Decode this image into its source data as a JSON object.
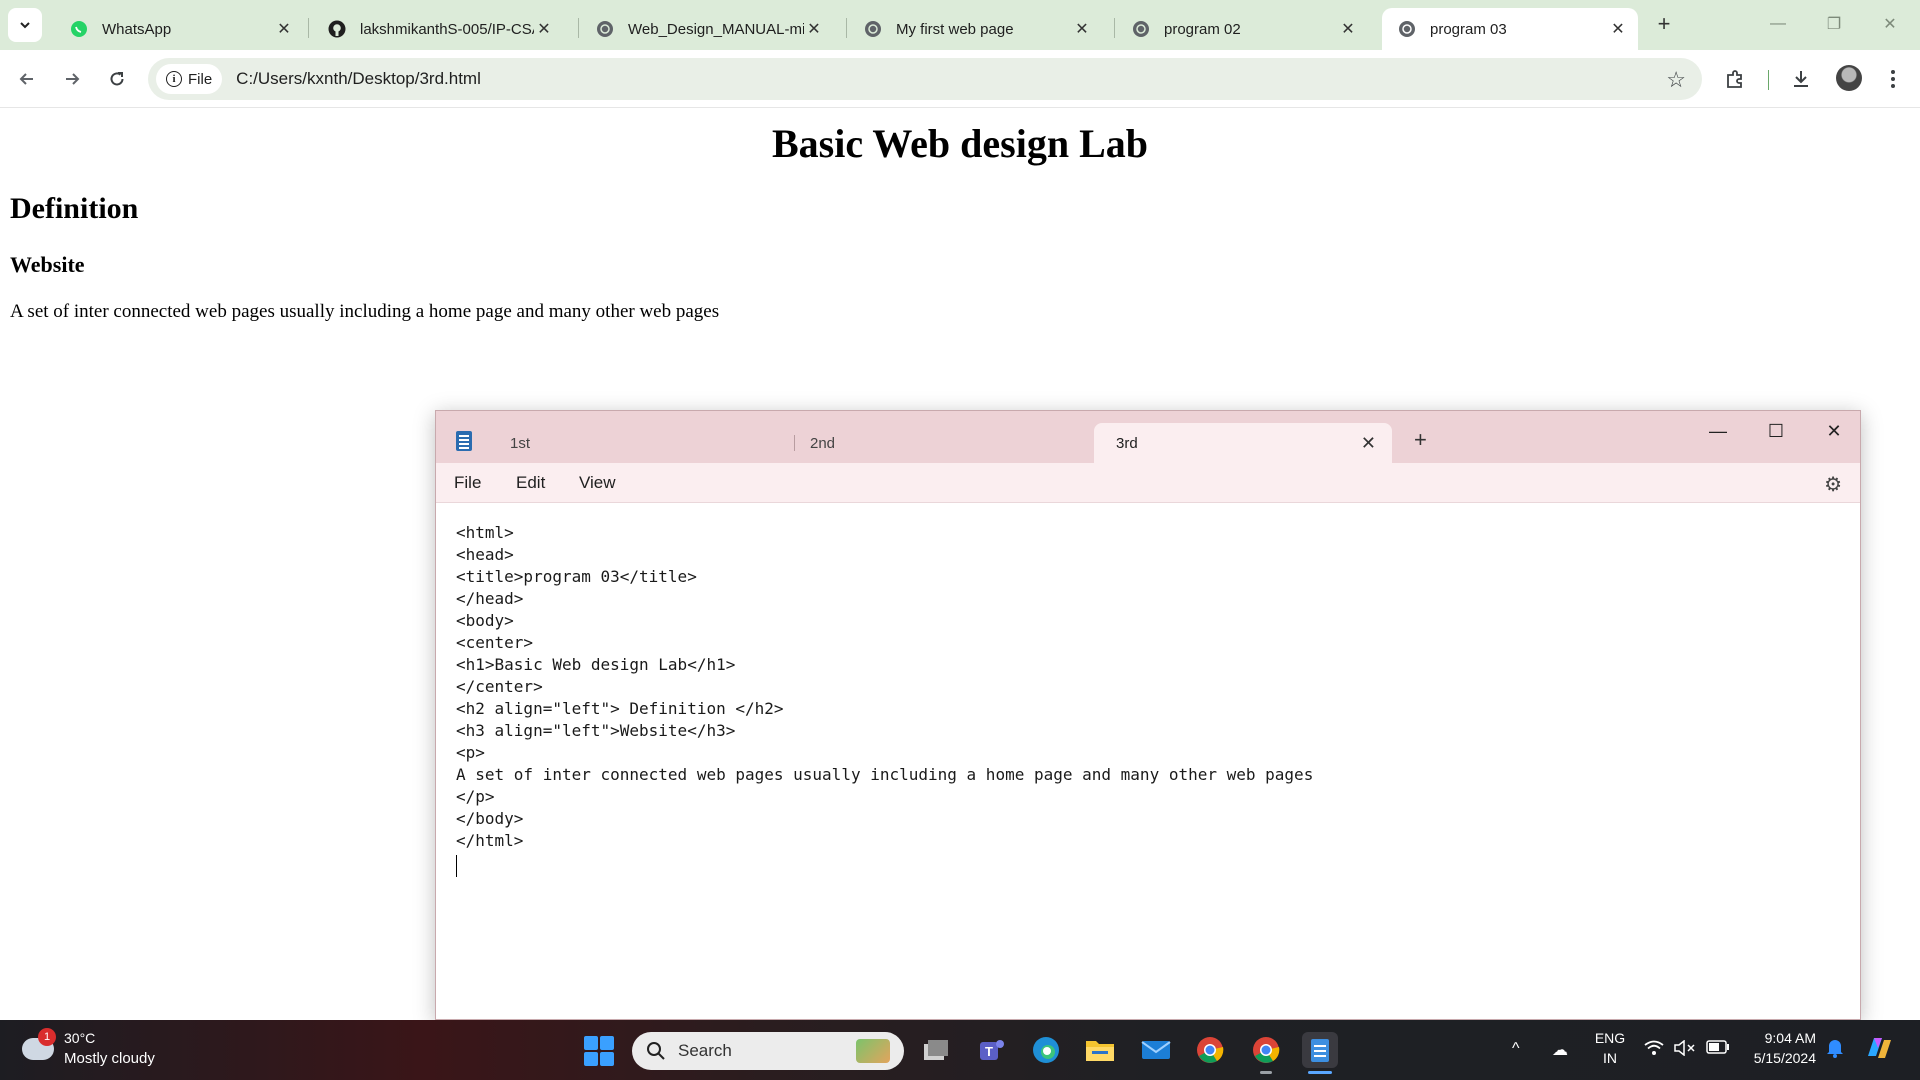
{
  "browser": {
    "tabs": [
      {
        "title": "WhatsApp",
        "icon": "whatsapp-icon"
      },
      {
        "title": "lakshmikanthS-005/IP-CSA",
        "icon": "github-icon"
      },
      {
        "title": "Web_Design_MANUAL-mi",
        "icon": "globe-icon"
      },
      {
        "title": "My first web page",
        "icon": "globe-icon"
      },
      {
        "title": "program 02",
        "icon": "globe-icon"
      },
      {
        "title": "program 03",
        "icon": "globe-icon",
        "active": true
      }
    ],
    "address": {
      "scheme_label": "File",
      "url": "C:/Users/kxnth/Desktop/3rd.html"
    }
  },
  "page": {
    "h1": "Basic Web design Lab",
    "h2": "Definition",
    "h3": "Website",
    "paragraph": "A set of inter connected web pages usually including a home page and many other web pages"
  },
  "notepad": {
    "tabs": [
      "1st",
      "2nd",
      "3rd"
    ],
    "active_tab": "3rd",
    "menu": [
      "File",
      "Edit",
      "View"
    ],
    "code_lines": [
      "<html>",
      "<head>",
      "<title>program 03</title>",
      "</head>",
      "<body>",
      "<center>",
      "<h1>Basic Web design Lab</h1>",
      "</center>",
      "<h2 align=\"left\"> Definition </h2>",
      "<h3 align=\"left\">Website</h3>",
      "<p>",
      "A set of inter connected web pages usually including a home page and many other web pages",
      "</p>",
      "</body>",
      "</html>"
    ]
  },
  "taskbar": {
    "weather": {
      "badge": "1",
      "temp": "30°C",
      "desc": "Mostly cloudy"
    },
    "search_label": "Search",
    "language": {
      "line1": "ENG",
      "line2": "IN"
    },
    "clock": {
      "time": "9:04 AM",
      "date": "5/15/2024"
    }
  },
  "colors": {
    "tabstrip_bg": "#dcebd9",
    "omnibox_bg": "#e9efe7",
    "notepad_titlebar": "#edd2d6",
    "notepad_menubar": "#fbeef0",
    "whatsapp_green": "#25d366"
  }
}
